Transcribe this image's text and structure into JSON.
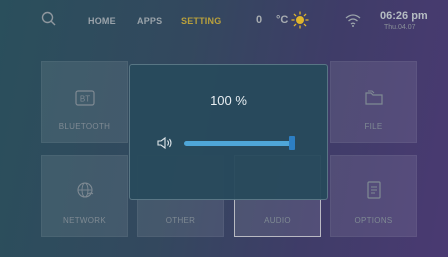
{
  "topbar": {
    "nav": [
      {
        "label": "HOME"
      },
      {
        "label": "APPS"
      },
      {
        "label": "SETTING",
        "active": true
      }
    ],
    "temperature": {
      "value": "0",
      "unit": "°C"
    },
    "time": "06:26 pm",
    "date": "Thu.04.07",
    "icons": [
      "search-icon",
      "sun-icon",
      "wifi-icon"
    ]
  },
  "tiles": [
    {
      "label": "BLUETOOTH",
      "icon": "bluetooth-icon",
      "icon_text": "BT"
    },
    {
      "label": "FILE",
      "icon": "folder-icon"
    },
    {
      "label": "NETWORK",
      "icon": "network-globe-icon"
    },
    {
      "label": "OTHER",
      "icon": "other-icon"
    },
    {
      "label": "AUDIO",
      "icon": "audio-icon",
      "selected": true
    },
    {
      "label": "OPTIONS",
      "icon": "options-icon"
    }
  ],
  "volume_dialog": {
    "value_text": "100 %",
    "level": 1.0,
    "icon": "speaker-icon"
  },
  "colors": {
    "active_nav": "#b9a03c",
    "slider_fill": "#4fa6d8",
    "slider_thumb": "#2d7fc4"
  }
}
